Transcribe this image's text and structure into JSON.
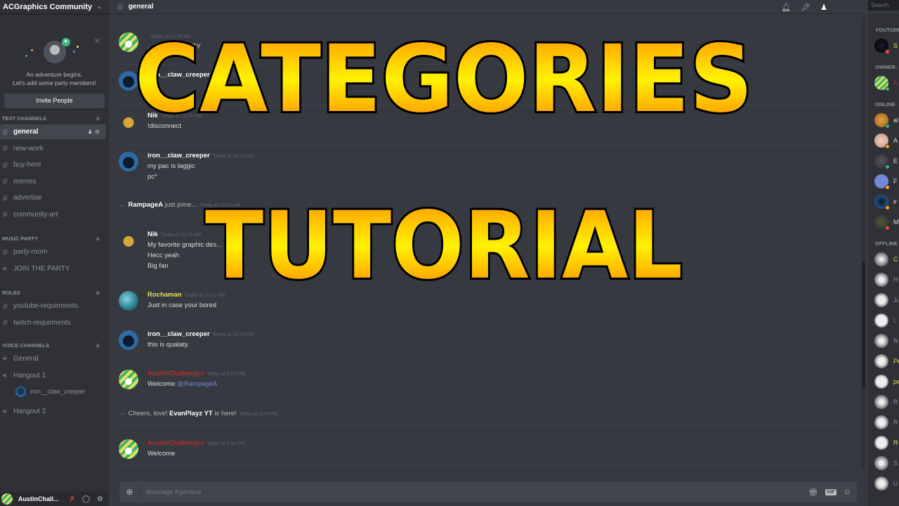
{
  "guild": {
    "name": "ACGraphics Community"
  },
  "invite_card": {
    "line1": "An adventure begins.",
    "line2": "Let's add some party members!",
    "button": "Invite People"
  },
  "categories": [
    {
      "name": "TEXT CHANNELS",
      "channels": [
        {
          "name": "general",
          "type": "text",
          "active": true
        },
        {
          "name": "new-work",
          "type": "text"
        },
        {
          "name": "buy-here",
          "type": "text"
        },
        {
          "name": "memes",
          "type": "text"
        },
        {
          "name": "advertise",
          "type": "text"
        },
        {
          "name": "community-art",
          "type": "text"
        }
      ]
    },
    {
      "name": "MUSIC PARTY",
      "channels": [
        {
          "name": "party-room",
          "type": "text"
        },
        {
          "name": "JOIN THE PARTY",
          "type": "voice"
        }
      ]
    },
    {
      "name": "ROLES",
      "channels": [
        {
          "name": "youtube-requirments",
          "type": "text"
        },
        {
          "name": "twitch-requirments",
          "type": "text"
        }
      ]
    },
    {
      "name": "VOICE CHANNELS",
      "channels": [
        {
          "name": "General",
          "type": "voice"
        },
        {
          "name": "Hangout 1",
          "type": "voice",
          "users": [
            "iron__claw_creeper"
          ]
        },
        {
          "name": "Hangout 2",
          "type": "voice"
        }
      ]
    }
  ],
  "user_panel": {
    "name": "AustinChall..."
  },
  "chat": {
    "channel": "general",
    "composer_placeholder": "Message #general",
    "messages": [
      {
        "author": "",
        "time": "Today at 12:15 AM",
        "lines": [
          "...s in the MU...TY"
        ],
        "color": "#ffffff"
      },
      {
        "author": "iron__claw_creeper",
        "time": "Today at 12:15 AM",
        "lines": [],
        "color": "#ffffff"
      },
      {
        "author": "Nik",
        "time": "Today at 12:15 AM",
        "lines": [
          "!disconnect"
        ],
        "color": "#ffffff"
      },
      {
        "author": "iron__claw_creeper",
        "time": "Today at 12:15 AM",
        "lines": [
          "my pac is laggic",
          "pc*"
        ],
        "color": "#ffffff"
      },
      {
        "author": "Nik",
        "time": "Today at 11:15 AM",
        "lines": [
          "My favorite graphic des...",
          "Hecc yeah",
          "Big fan"
        ],
        "color": "#ffffff"
      },
      {
        "author": "Rochaman",
        "time": "Today at 11:15 AM",
        "lines": [
          "Just in case your bored"
        ],
        "color": "#e8e05a"
      },
      {
        "author": "iron__claw_creeper",
        "time": "Today at 12:23 PM",
        "lines": [
          "this is qualaty."
        ],
        "color": "#ffffff"
      },
      {
        "author": "AustinChallenges",
        "time": "Today at 2:19 PM",
        "lines": [
          "Welcome "
        ],
        "mention": "@RampageA",
        "color": "#c0282d"
      },
      {
        "author": "AustinChallenges",
        "time": "Today at 2:34 PM",
        "lines": [
          "Welcome"
        ],
        "color": "#c0282d"
      }
    ],
    "system": [
      {
        "user": "RampageA",
        "text": " just joine...",
        "time": "Today at 10:43 AM"
      },
      {
        "prefix": "Cheers, love! ",
        "user": "EvanPlayz YT",
        "text": " is here!",
        "time": "Today at 2:34 PM"
      }
    ],
    "scroll_position": 0.75
  },
  "header": {
    "search_placeholder": "Search"
  },
  "members": {
    "groups": [
      {
        "name": "YOUTUBE",
        "members": [
          {
            "name": "S",
            "status": "dnd",
            "color": "#e8e05a"
          }
        ]
      },
      {
        "name": "OWNER-",
        "members": [
          {
            "name": "A",
            "status": "online",
            "color": "#c0282d"
          }
        ]
      },
      {
        "name": "ONLINE-",
        "members": [
          {
            "name": "al",
            "status": "online",
            "color": "#dcddde"
          },
          {
            "name": "A",
            "status": "idle",
            "color": "#dcddde"
          },
          {
            "name": "E",
            "status": "online",
            "color": "#dcddde"
          },
          {
            "name": "F",
            "status": "idle",
            "color": "#dcddde"
          },
          {
            "name": "ir",
            "status": "idle",
            "color": "#dcddde"
          },
          {
            "name": "M",
            "status": "dnd",
            "color": "#dcddde"
          }
        ]
      },
      {
        "name": "OFFLINE",
        "members": [
          {
            "name": "C",
            "color": "#e8e05a"
          },
          {
            "name": "H",
            "color": "#8e9297"
          },
          {
            "name": "Ju",
            "color": "#8e9297"
          },
          {
            "name": "L",
            "color": "#6b6f75"
          },
          {
            "name": "N",
            "color": "#8e9297"
          },
          {
            "name": "Pe",
            "color": "#e8e05a"
          },
          {
            "name": "pe",
            "color": "#e8e05a"
          },
          {
            "name": "R",
            "color": "#8e9297"
          },
          {
            "name": "R",
            "color": "#8e9297"
          },
          {
            "name": "R",
            "color": "#e8e05a"
          },
          {
            "name": "S",
            "color": "#8e9297"
          },
          {
            "name": "U",
            "color": "#8e9297"
          }
        ]
      }
    ]
  },
  "overlay": {
    "line1": "CATEGORIES",
    "line2": "TUTORIAL"
  },
  "colors": {
    "status_online": "#43b581",
    "status_idle": "#faa61a",
    "status_dnd": "#f04747",
    "accent": "#7289da"
  }
}
